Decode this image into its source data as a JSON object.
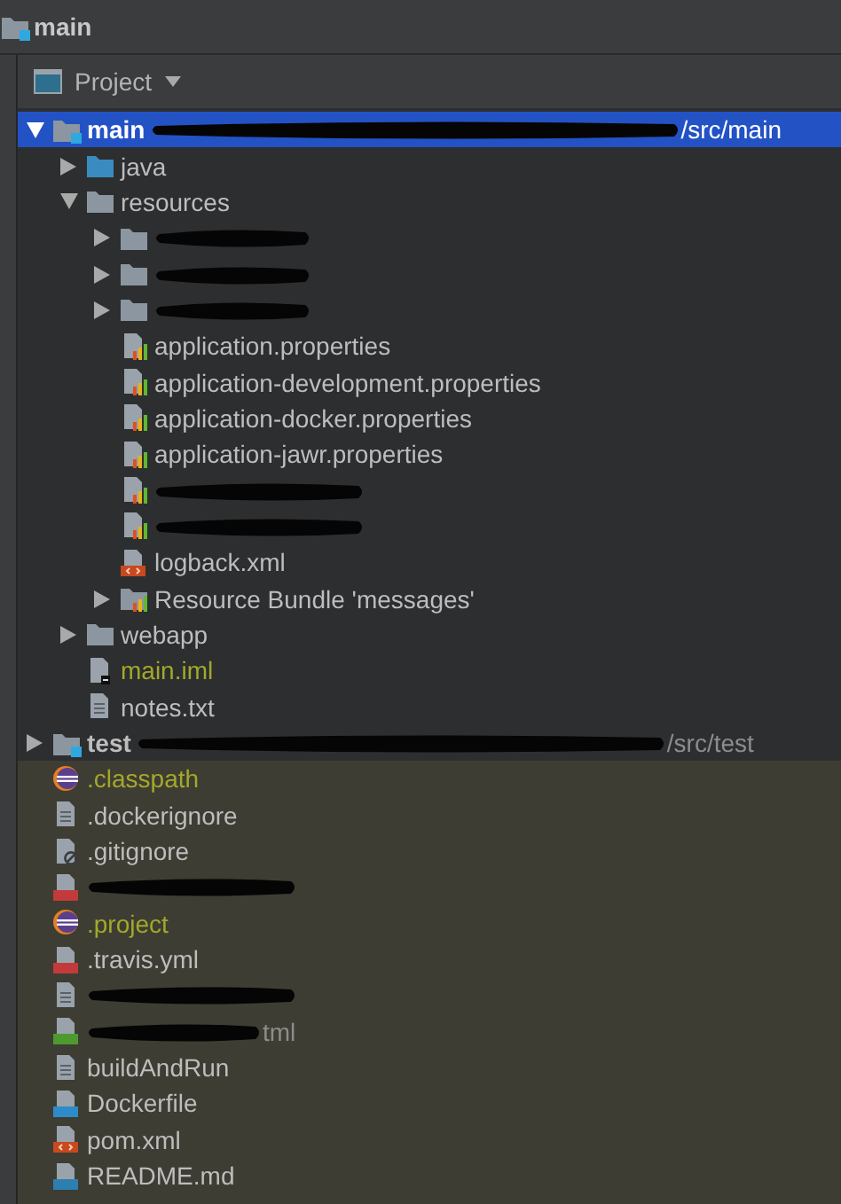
{
  "window": {
    "title": "main"
  },
  "panel": {
    "title": "Project"
  },
  "tree": [
    {
      "label": "main",
      "kind": "module",
      "redacted": true,
      "suffix": "/src/main",
      "expanded": true,
      "selected": true,
      "ignored": false,
      "children": [
        {
          "label": "java",
          "kind": "source-folder",
          "redacted": false,
          "expanded": false,
          "selected": false,
          "ignored": false
        },
        {
          "label": "resources",
          "kind": "folder",
          "redacted": false,
          "expanded": true,
          "selected": false,
          "ignored": false,
          "children": [
            {
              "kind": "folder",
              "redacted": true,
              "expanded": false,
              "selected": false
            },
            {
              "kind": "folder",
              "redacted": true,
              "expanded": false,
              "selected": false
            },
            {
              "kind": "folder",
              "redacted": true,
              "expanded": false,
              "selected": false
            },
            {
              "label": "application.properties",
              "kind": "properties",
              "redacted": false,
              "selected": false,
              "ignored": false
            },
            {
              "label": "application-development.properties",
              "kind": "properties",
              "redacted": false,
              "selected": false,
              "ignored": false
            },
            {
              "label": "application-docker.properties",
              "kind": "properties",
              "redacted": false,
              "selected": false,
              "ignored": false
            },
            {
              "label": "application-jawr.properties",
              "kind": "properties",
              "redacted": false,
              "selected": false,
              "ignored": false
            },
            {
              "kind": "properties",
              "redacted": true,
              "selected": false
            },
            {
              "kind": "properties",
              "redacted": true,
              "selected": false
            },
            {
              "label": "logback.xml",
              "kind": "xml",
              "redacted": false,
              "selected": false,
              "ignored": false
            },
            {
              "label": "Resource Bundle 'messages'",
              "kind": "bundle",
              "redacted": false,
              "expanded": false,
              "selected": false,
              "ignored": false
            }
          ]
        },
        {
          "label": "webapp",
          "kind": "folder",
          "redacted": false,
          "expanded": false,
          "selected": false,
          "ignored": false
        },
        {
          "label": "main.iml",
          "kind": "iml",
          "redacted": false,
          "selected": false,
          "ignored": true
        },
        {
          "label": "notes.txt",
          "kind": "text",
          "redacted": false,
          "selected": false,
          "ignored": false
        }
      ]
    },
    {
      "label": "test",
      "kind": "module",
      "redacted": true,
      "suffix": "/src/test",
      "expanded": false,
      "selected": false,
      "ignored": false
    }
  ],
  "root_files": [
    {
      "label": ".classpath",
      "kind": "eclipse",
      "redacted": false,
      "selected": false,
      "ignored": true
    },
    {
      "label": ".dockerignore",
      "kind": "text",
      "redacted": false,
      "selected": false,
      "ignored": false
    },
    {
      "label": ".gitignore",
      "kind": "gitignore",
      "redacted": false,
      "selected": false,
      "ignored": false
    },
    {
      "kind": "yml",
      "redacted": true,
      "selected": false
    },
    {
      "label": ".project",
      "kind": "eclipse",
      "redacted": false,
      "selected": false,
      "ignored": true
    },
    {
      "label": ".travis.yml",
      "kind": "yml",
      "redacted": false,
      "selected": false,
      "ignored": false
    },
    {
      "kind": "text",
      "redacted": true,
      "selected": false
    },
    {
      "kind": "html",
      "redacted": true,
      "suffix": "tml",
      "selected": false
    },
    {
      "label": "buildAndRun",
      "kind": "text",
      "redacted": false,
      "selected": false,
      "ignored": false
    },
    {
      "label": "Dockerfile",
      "kind": "dockerfile",
      "redacted": false,
      "selected": false,
      "ignored": false
    },
    {
      "label": "pom.xml",
      "kind": "xml",
      "redacted": false,
      "selected": false,
      "ignored": false
    },
    {
      "label": "README.md",
      "kind": "markdown",
      "redacted": false,
      "selected": false,
      "ignored": false
    }
  ]
}
